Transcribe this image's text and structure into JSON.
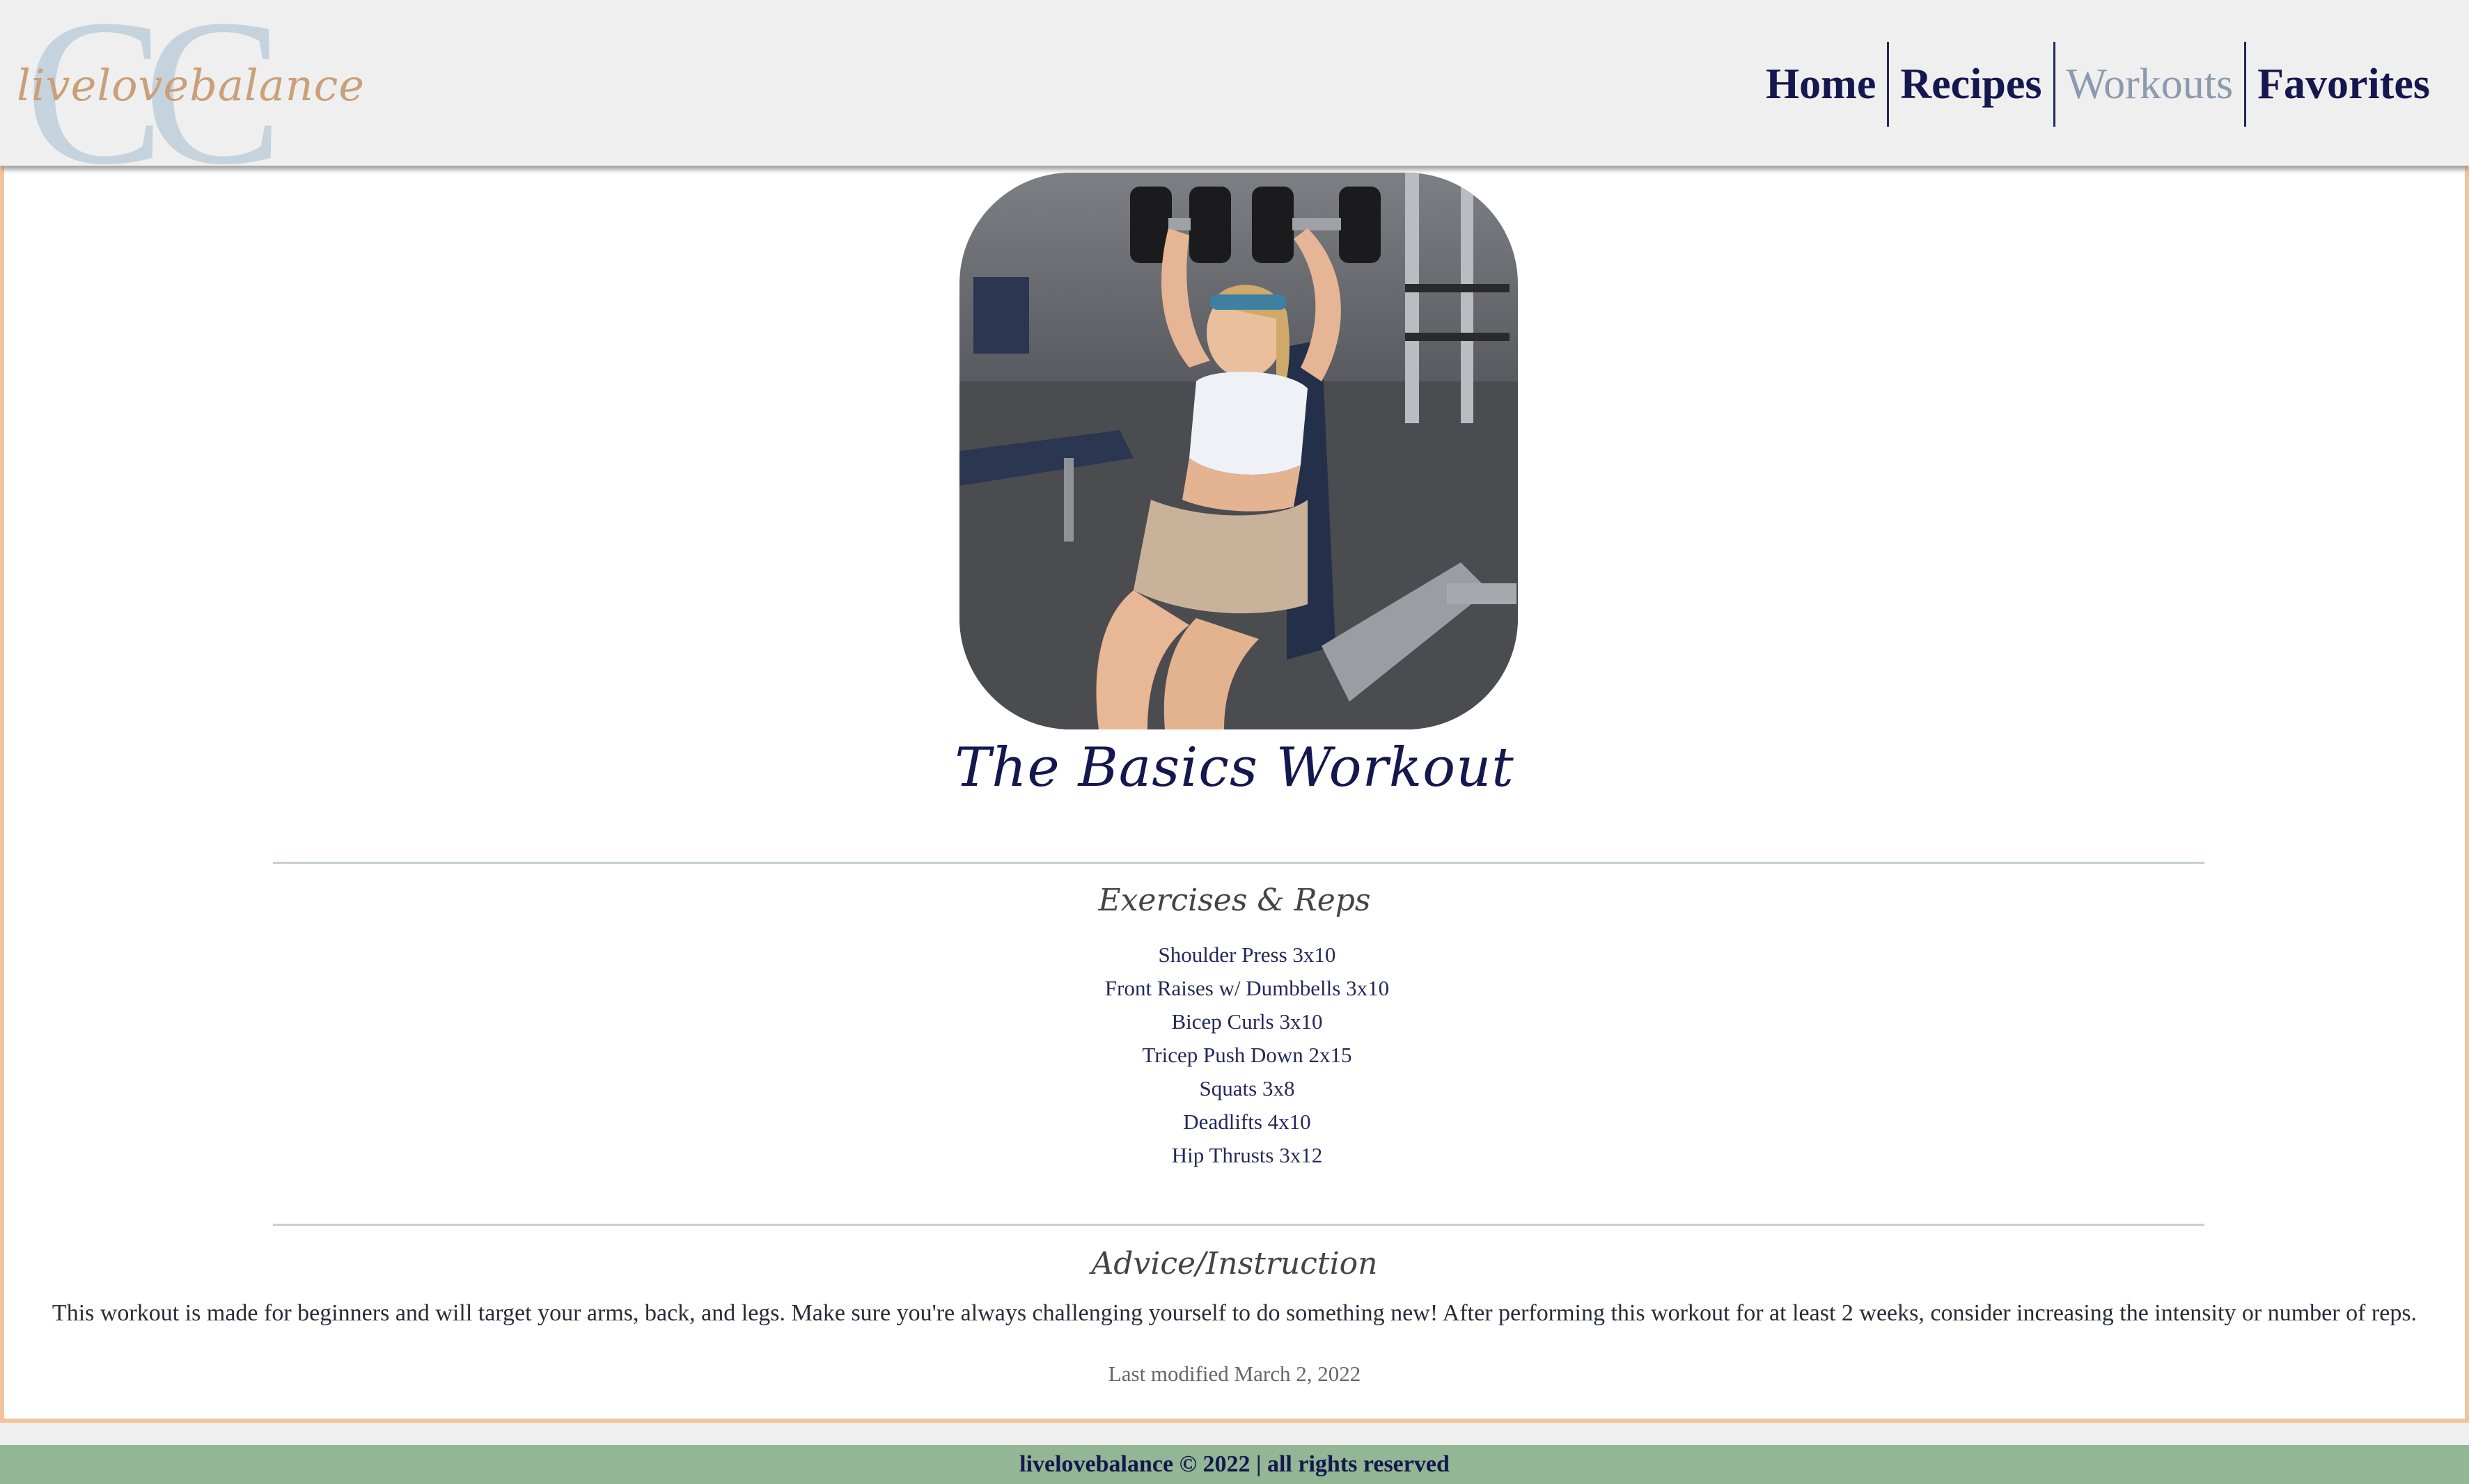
{
  "header": {
    "logo_monogram": "CC",
    "logo_text": "livelovebalance",
    "nav": [
      {
        "label": "Home",
        "active": false
      },
      {
        "label": "Recipes",
        "active": false
      },
      {
        "label": "Workouts",
        "active": true
      },
      {
        "label": "Favorites",
        "active": false
      }
    ]
  },
  "main": {
    "title": "The Basics Workout",
    "exercises_heading": "Exercises & Reps",
    "exercises": [
      "Shoulder Press 3x10",
      "Front Raises w/ Dumbbells 3x10",
      "Bicep Curls 3x10",
      "Tricep Push Down 2x15",
      "Squats 3x8",
      "Deadlifts 4x10",
      "Hip Thrusts 3x12"
    ],
    "advice_heading": "Advice/Instruction",
    "advice_text": "This workout is made for beginners and will target your arms, back, and legs. Make sure you're always challenging yourself to do something new! After performing this workout for at least 2 weeks, consider increasing the intensity or number of reps.",
    "last_modified": "Last modified March 2, 2022"
  },
  "footer": {
    "text": "livelovebalance © 2022 | all rights reserved"
  },
  "colors": {
    "navy": "#14184e",
    "active_nav": "#8c9ab0",
    "border_peach": "#f3c49b",
    "footer_green": "#93b694",
    "logo_tan": "#c9a07a",
    "logo_blue": "#c5d3de"
  }
}
